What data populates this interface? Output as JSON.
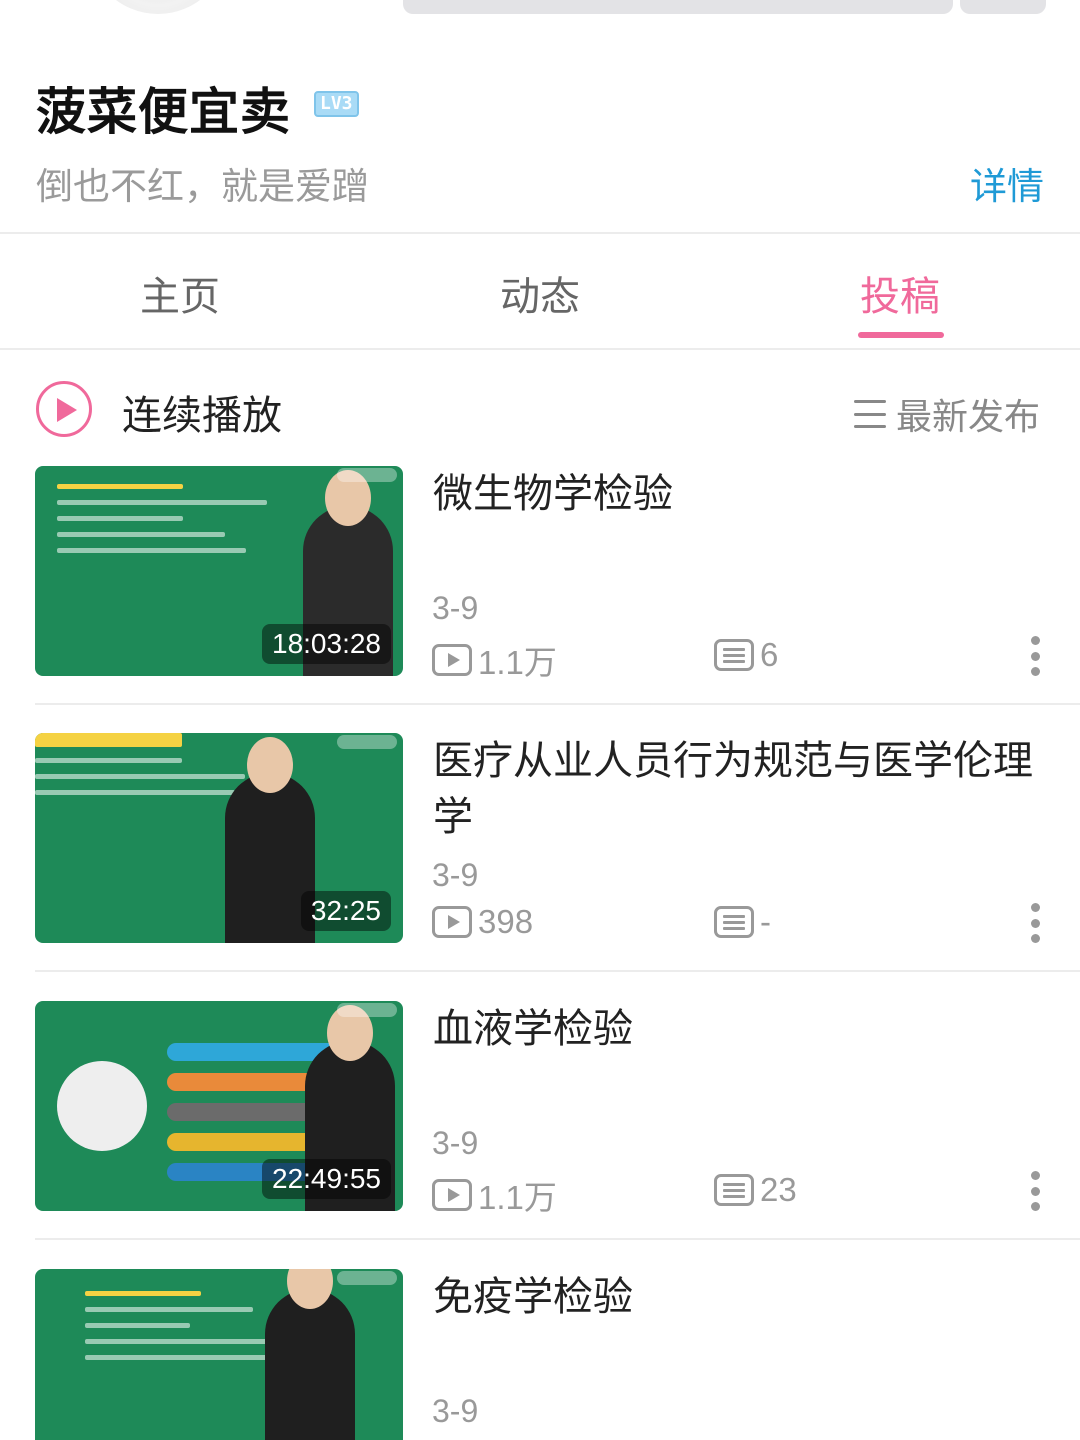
{
  "profile": {
    "username": "菠菜便宜卖",
    "level": "LV3",
    "signature": "倒也不红，就是爱蹭",
    "details_link": "详情"
  },
  "tabs": [
    {
      "label": "主页",
      "active": false
    },
    {
      "label": "动态",
      "active": false
    },
    {
      "label": "投稿",
      "active": true
    }
  ],
  "toolbar": {
    "autoplay_label": "连续播放",
    "sort_label": "最新发布"
  },
  "colors": {
    "accent_pink": "#f0699b",
    "link_blue": "#1f9ad6",
    "thumb_green": "#1e8a58"
  },
  "videos": [
    {
      "title": "微生物学检验",
      "duration": "18:03:28",
      "date": "3-9",
      "views": "1.1万",
      "danmaku": "6"
    },
    {
      "title": "医疗从业人员行为规范与医学伦理学",
      "duration": "32:25",
      "date": "3-9",
      "views": "398",
      "danmaku": "-"
    },
    {
      "title": "血液学检验",
      "duration": "22:49:55",
      "date": "3-9",
      "views": "1.1万",
      "danmaku": "23"
    },
    {
      "title": "免疫学检验",
      "duration": "",
      "date": "3-9",
      "views": "",
      "danmaku": ""
    }
  ]
}
